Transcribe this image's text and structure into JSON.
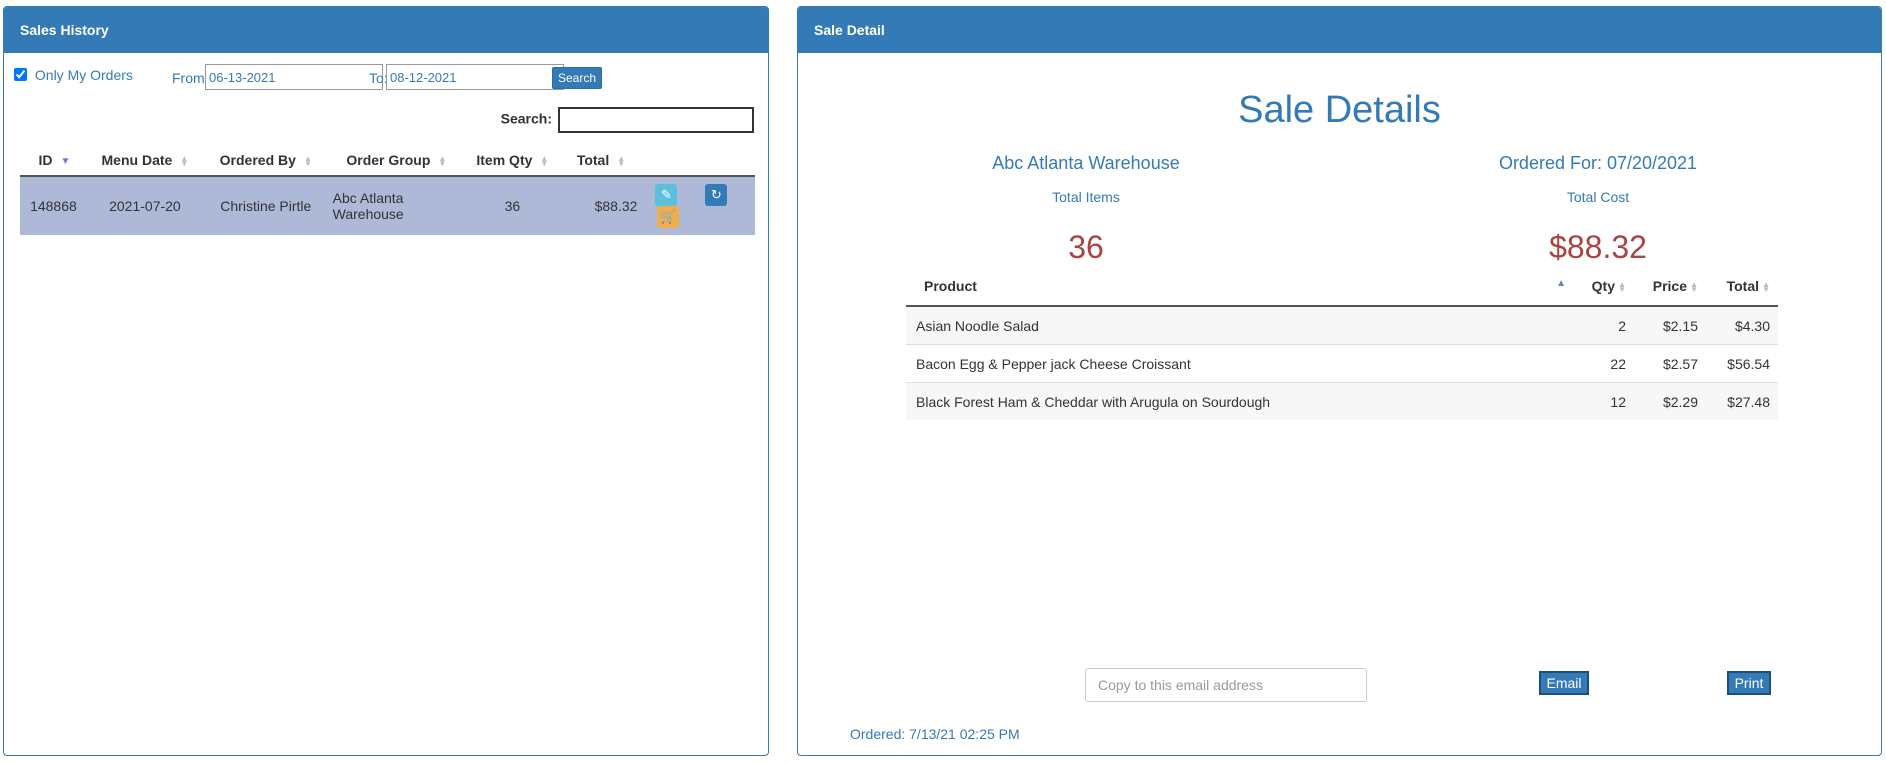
{
  "sales_history": {
    "title": "Sales History",
    "only_my_orders_label": "Only My Orders",
    "only_my_orders_checked": true,
    "from_label": "From:",
    "from_value": "06-13-2021",
    "to_label": "To:",
    "to_value": "08-12-2021",
    "search_button": "Search",
    "search_label": "Search:",
    "search_value": "",
    "columns": [
      "ID",
      "Menu Date",
      "Ordered By",
      "Order Group",
      "Item Qty",
      "Total"
    ],
    "rows": [
      {
        "id": "148868",
        "menu_date": "2021-07-20",
        "ordered_by": "Christine Pirtle",
        "order_group_line1": "Abc Atlanta",
        "order_group_line2": "Warehouse",
        "item_qty": "36",
        "total": "$88.32",
        "actions": [
          "edit-icon",
          "refresh-icon",
          "cart-icon"
        ]
      }
    ]
  },
  "sale_detail": {
    "panel_title": "Sale Detail",
    "heading": "Sale Details",
    "group_name": "Abc Atlanta Warehouse",
    "ordered_for": "Ordered For: 07/20/2021",
    "total_items_label": "Total Items",
    "total_items_value": "36",
    "total_cost_label": "Total Cost",
    "total_cost_value": "$88.32",
    "columns": [
      "Product",
      "Qty",
      "Price",
      "Total"
    ],
    "items": [
      {
        "product": "Asian Noodle Salad",
        "qty": "2",
        "price": "$2.15",
        "total": "$4.30"
      },
      {
        "product": "Bacon Egg & Pepper jack Cheese Croissant",
        "qty": "22",
        "price": "$2.57",
        "total": "$56.54"
      },
      {
        "product": "Black Forest Ham & Cheddar with Arugula on Sourdough",
        "qty": "12",
        "price": "$2.29",
        "total": "$27.48"
      }
    ],
    "email_placeholder": "Copy to this email address",
    "email_button": "Email",
    "print_button": "Print",
    "ordered_timestamp": "Ordered: 7/13/21 02:25 PM"
  },
  "colors": {
    "primary": "#337ab7",
    "selected_row": "#aeb9d8",
    "value_red": "#a94442",
    "info": "#5bc0de",
    "warning": "#f0ad4e"
  }
}
